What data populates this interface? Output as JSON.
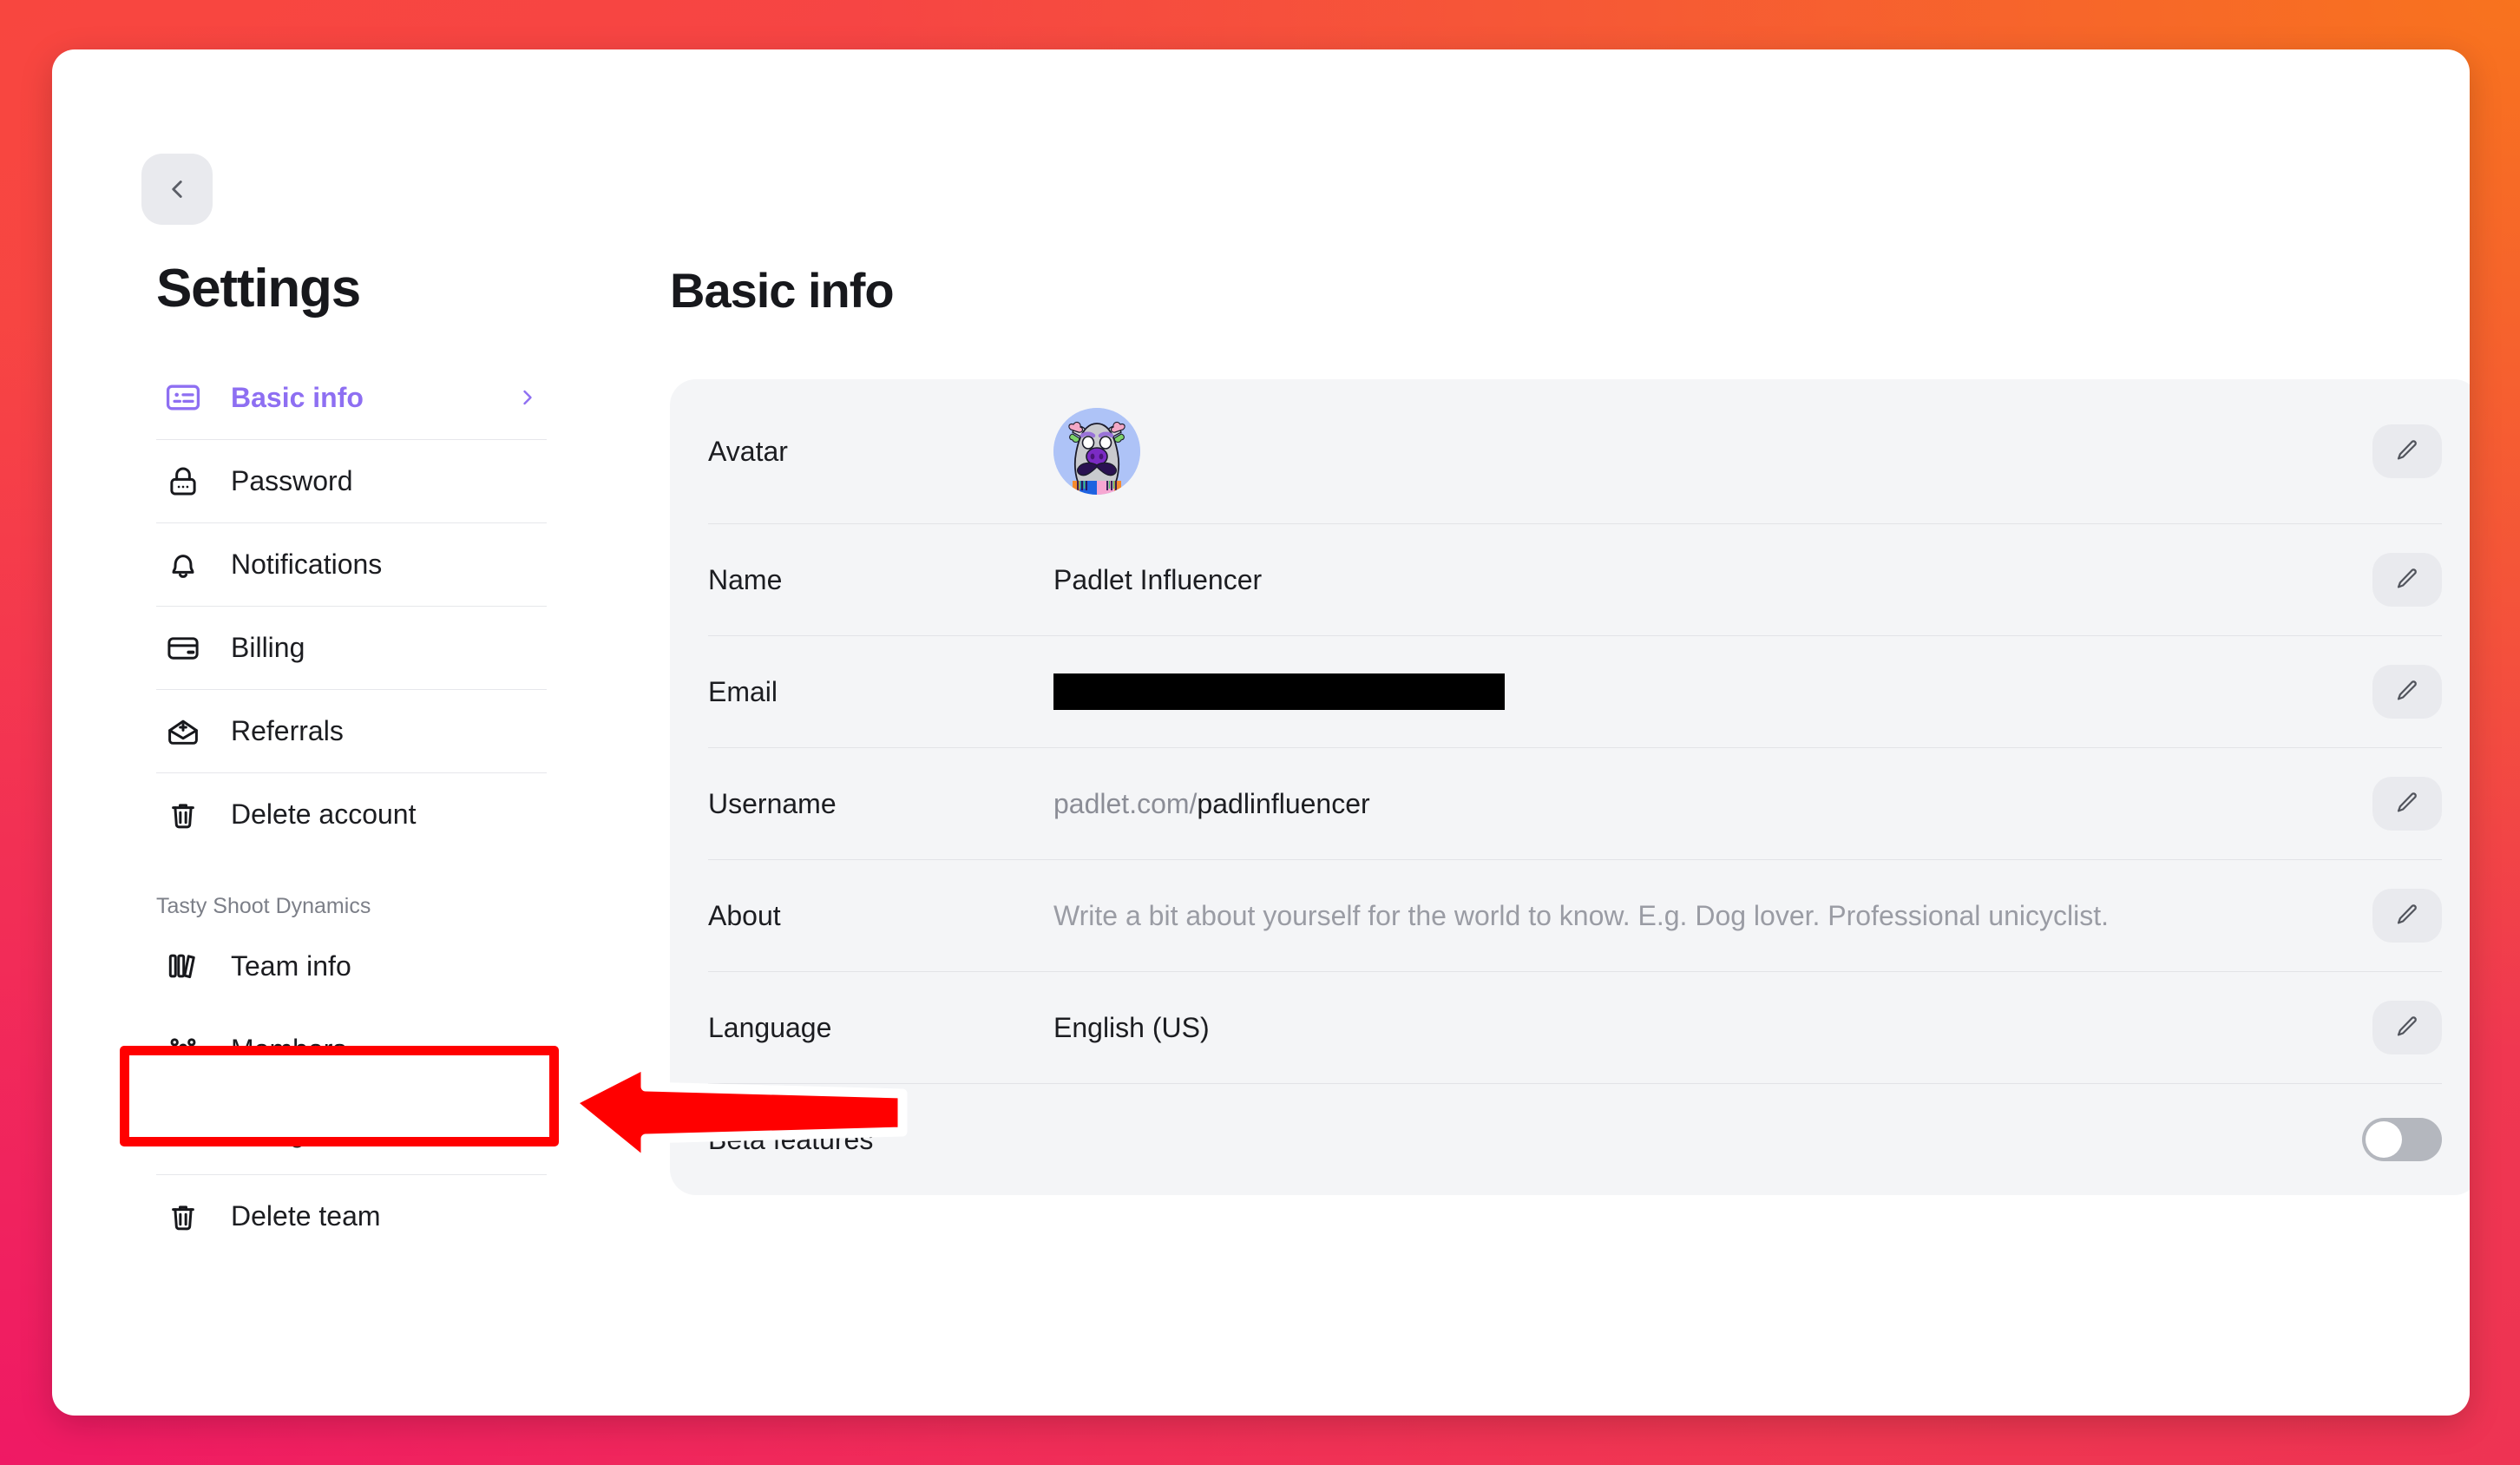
{
  "window": {
    "back_button_label": "Back",
    "page_title": "Settings"
  },
  "sidebar": {
    "account_items": [
      {
        "label": "Basic info",
        "icon": "id-card-icon",
        "active": true,
        "chevron": "chevron-right-icon"
      },
      {
        "label": "Password",
        "icon": "lock-icon",
        "active": false
      },
      {
        "label": "Notifications",
        "icon": "bell-icon",
        "active": false
      },
      {
        "label": "Billing",
        "icon": "credit-card-icon",
        "active": false
      },
      {
        "label": "Referrals",
        "icon": "envelope-plus-icon",
        "active": false
      },
      {
        "label": "Delete account",
        "icon": "trash-icon",
        "active": false
      }
    ],
    "team_group_title": "Tasty Shoot Dynamics",
    "team_items": [
      {
        "label": "Team info",
        "icon": "books-icon",
        "highlighted": false
      },
      {
        "label": "Members",
        "icon": "people-group-icon",
        "highlighted": true
      },
      {
        "label": "Billing",
        "icon": "credit-card-icon",
        "highlighted": false
      },
      {
        "label": "Delete team",
        "icon": "trash-icon",
        "highlighted": false
      }
    ]
  },
  "main": {
    "title": "Basic info",
    "rows": [
      {
        "label": "Avatar",
        "value": "",
        "type": "avatar",
        "action": "edit-pencil-icon"
      },
      {
        "label": "Name",
        "value": "Padlet Influencer",
        "type": "text",
        "action": "edit-pencil-icon"
      },
      {
        "label": "Email",
        "value": "",
        "type": "redacted",
        "action": "edit-pencil-icon"
      },
      {
        "label": "Username",
        "value": "padlet.com/padlinfluencer",
        "value_prefix": "padlet.com/",
        "value_handle": "padlinfluencer",
        "type": "username",
        "action": "edit-pencil-icon"
      },
      {
        "label": "About",
        "value": "Write a bit about yourself for the world to know. E.g. Dog lover. Professional unicyclist.",
        "type": "placeholder",
        "action": "edit-pencil-icon"
      },
      {
        "label": "Language",
        "value": "English (US)",
        "type": "text",
        "action": "edit-pencil-icon"
      },
      {
        "label": "Beta features",
        "value": "",
        "type": "toggle",
        "toggle_on": false
      }
    ]
  },
  "annotations": {
    "highlight_target": "Members",
    "arrow_direction": "left",
    "color": "#FF0000"
  },
  "colors": {
    "accent_purple": "#8E6FF2",
    "card_background": "#F4F5F7",
    "annotation_red": "#FF0000",
    "toggle_off": "#B4B7BE",
    "background_gradient_top_left": "#F8463F",
    "background_gradient_top_right": "#F8731E",
    "background_gradient_bottom_left": "#EF1964",
    "background_gradient_bottom_right": "#EE3353"
  }
}
